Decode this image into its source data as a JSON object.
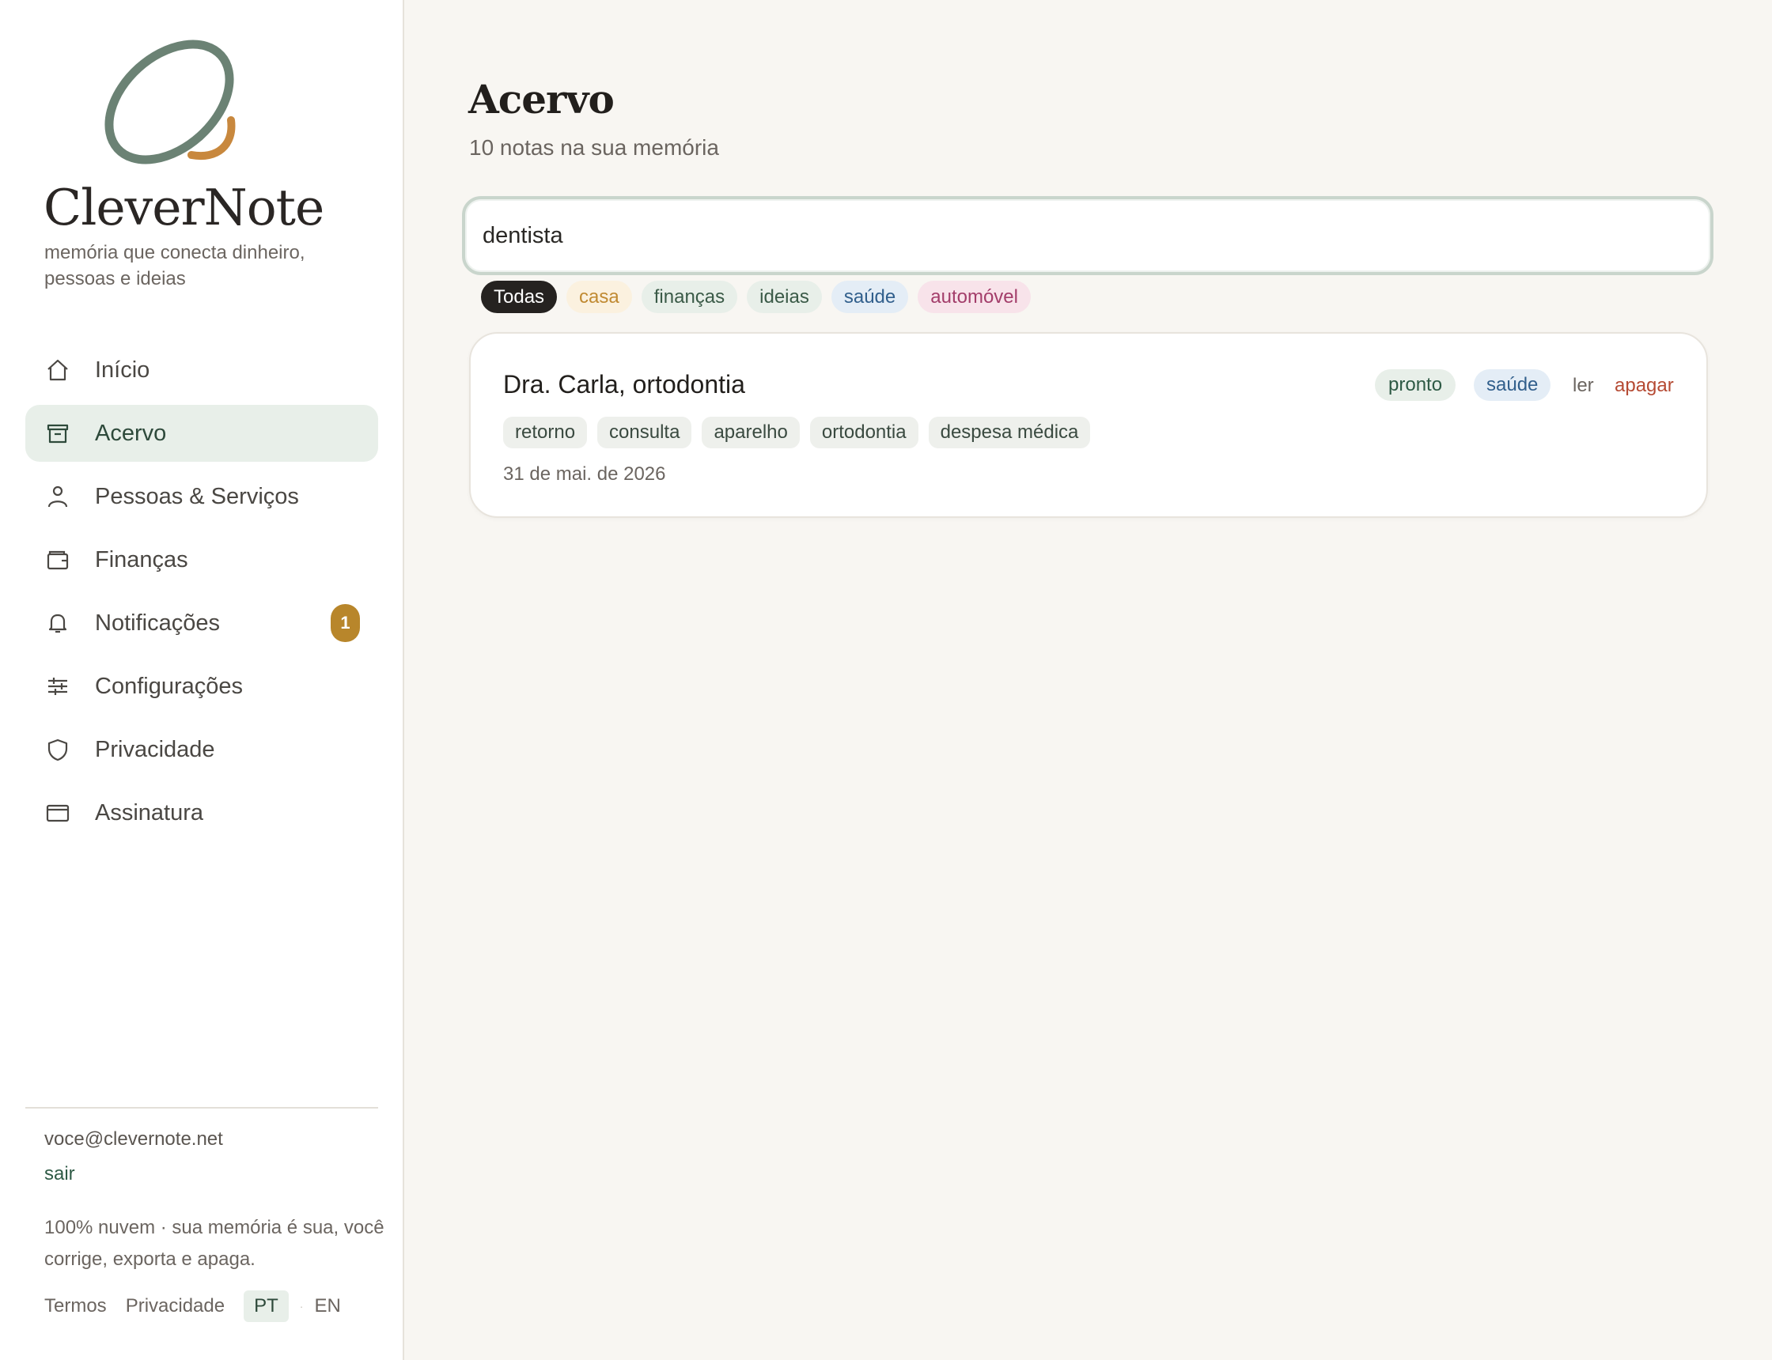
{
  "brand": {
    "name": "CleverNote",
    "tagline": "memória que conecta dinheiro, pessoas e ideias",
    "logo_colors": {
      "ring": "#6b8274",
      "accent": "#c8883e"
    }
  },
  "nav": {
    "items": [
      {
        "label": "Início",
        "icon": "home-icon"
      },
      {
        "label": "Acervo",
        "icon": "archive-icon",
        "active": true
      },
      {
        "label": "Pessoas & Serviços",
        "icon": "person-icon"
      },
      {
        "label": "Finanças",
        "icon": "wallet-icon"
      },
      {
        "label": "Notificações",
        "icon": "bell-icon",
        "badge": "1"
      },
      {
        "label": "Configurações",
        "icon": "sliders-icon"
      },
      {
        "label": "Privacidade",
        "icon": "shield-icon"
      },
      {
        "label": "Assinatura",
        "icon": "card-icon"
      }
    ]
  },
  "account": {
    "email": "voce@clevernote.net",
    "logout_label": "sair",
    "note": "100% nuvem · sua memória é sua, você corrige, exporta e apaga."
  },
  "footer": {
    "terms": "Termos",
    "privacy": "Privacidade",
    "lang_pt": "PT",
    "lang_sep": "·",
    "lang_en": "EN"
  },
  "main": {
    "title": "Acervo",
    "subtitle": "10 notas na sua memória",
    "search": {
      "value": "dentista",
      "placeholder": ""
    },
    "filters": [
      "Todas",
      "casa",
      "finanças",
      "ideias",
      "saúde",
      "automóvel"
    ],
    "active_filter": "Todas"
  },
  "notes": [
    {
      "title": "Dra. Carla, ortodontia",
      "status": "pronto",
      "category": "saúde",
      "read_label": "ler",
      "delete_label": "apagar",
      "tags": [
        "retorno",
        "consulta",
        "aparelho",
        "ortodontia",
        "despesa médica"
      ],
      "date": "31 de mai. de 2026"
    }
  ],
  "colors": {
    "accent_green": "#2e5a45",
    "badge": "#b8862b",
    "delete": "#b54a33",
    "background": "#f8f6f2"
  }
}
